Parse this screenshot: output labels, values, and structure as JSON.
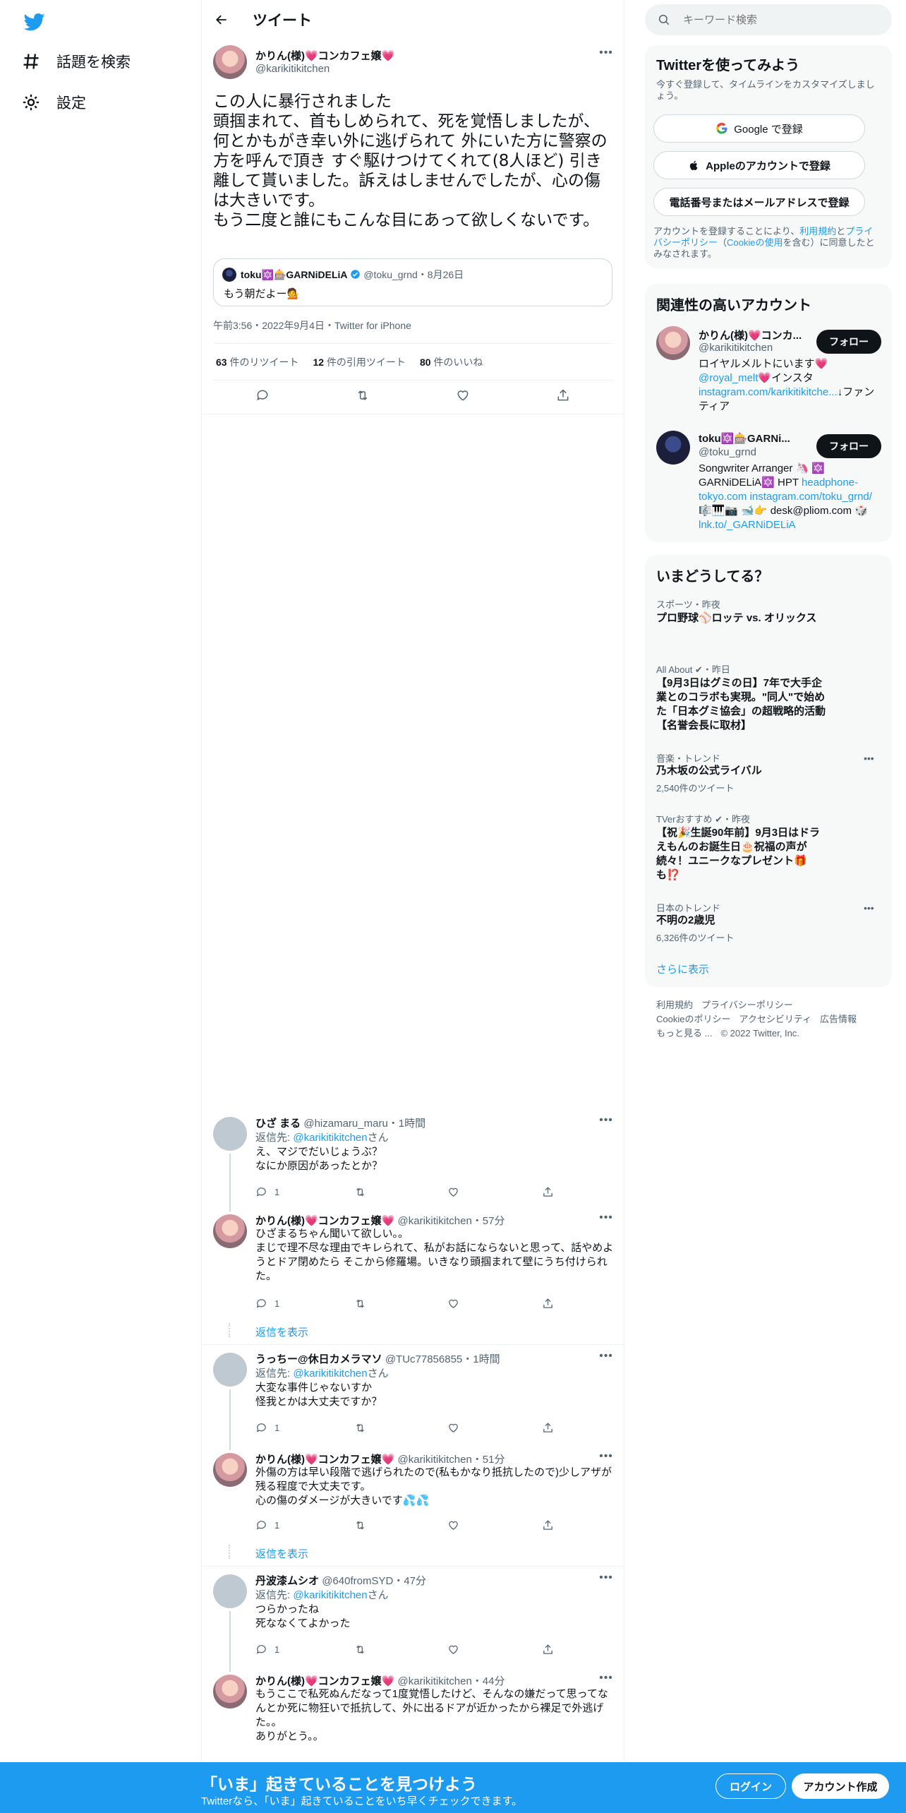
{
  "nav": {
    "explore": "話題を検索",
    "settings": "設定"
  },
  "header": {
    "title": "ツイート"
  },
  "main_tweet": {
    "name": "かりん(様)💗コンカフェ嬢💗",
    "handle": "@karikitikitchen",
    "text": "この人に暴行されました\n頭掴まれて、首もしめられて、死を覚悟しましたが、何とかもがき幸い外に逃げられて 外にいた方に警察の方を呼んで頂き すぐ駆けつけてくれて(8人ほど) 引き離して貰いました。訴えはしませんでしたが、心の傷は大きいです。\nもう二度と誰にもこんな目にあって欲しくないです。",
    "quote": {
      "name": "toku🔯🎰GARNiDELiA",
      "handle": "@toku_grnd",
      "date": "・8月26日",
      "text": "もう朝だよー💁"
    },
    "meta": "午前3:56・2022年9月4日・Twitter for iPhone",
    "retweets": "63",
    "retweets_label": "件のリツイート",
    "quotes": "12",
    "quotes_label": "件の引用ツイート",
    "likes": "80",
    "likes_label": "件のいいね"
  },
  "replies": [
    {
      "name": "ひざ まる",
      "handle": "@hizamaru_maru",
      "time": "・1時間",
      "reply_to_prefix": "返信先: ",
      "reply_to": "@karikitikitchen",
      "reply_to_suffix": "さん",
      "text": "え、マジでだいじょうぶ？\nなにか原因があったとか？",
      "replies_count": "1"
    },
    {
      "name": "かりん(様)💗コンカフェ嬢💗",
      "handle": "@karikitikitchen",
      "time": "・57分",
      "text": "ひざまるちゃん聞いて欲しい。。\nまじで理不尽な理由でキレられて、私がお話にならないと思って、話やめようとドア閉めたら そこから修羅場。いきなり頭掴まれて壁にうち付けられた。",
      "replies_count": "1"
    },
    {
      "name": "うっちー@休日カメラマソ",
      "handle": "@TUc77856855",
      "time": "・1時間",
      "reply_to_prefix": "返信先: ",
      "reply_to": "@karikitikitchen",
      "reply_to_suffix": "さん",
      "text": "大変な事件じゃないすか\n怪我とかは大丈夫ですか？",
      "replies_count": "1"
    },
    {
      "name": "かりん(様)💗コンカフェ嬢💗",
      "handle": "@karikitikitchen",
      "time": "・51分",
      "text": "外傷の方は早い段階で逃げられたので(私もかなり抵抗したので)少しアザが残る程度で大丈夫です。\n心の傷のダメージが大きいです💦💦",
      "replies_count": "1"
    },
    {
      "name": "丹波漆ムシオ",
      "handle": "@640fromSYD",
      "time": "・47分",
      "reply_to_prefix": "返信先: ",
      "reply_to": "@karikitikitchen",
      "reply_to_suffix": "さん",
      "text": "つらかったね\n死ななくてよかった",
      "replies_count": "1"
    },
    {
      "name": "かりん(様)💗コンカフェ嬢💗",
      "handle": "@karikitikitchen",
      "time": "・44分",
      "text": "もうここで私死ぬんだなって1度覚悟したけど、そんなの嫌だって思ってなんとか死に物狂いで抵抗して、外に出るドアが近かったから裸足で外逃げた。。\nありがとう。。",
      "replies_count": ""
    }
  ],
  "show_replies": "返信を表示",
  "search": {
    "placeholder": "キーワード検索"
  },
  "signup_card": {
    "title": "Twitterを使ってみよう",
    "subtitle": "今すぐ登録して、タイムラインをカスタマイズしましょう。",
    "google": "Google で登録",
    "apple": "Appleのアカウントで登録",
    "phone": "電話番号またはメールアドレスで登録",
    "legal_1": "アカウントを登録することにより、",
    "legal_terms": "利用規約",
    "legal_2": "と",
    "legal_privacy": "プライバシーポリシー",
    "legal_3": "（",
    "legal_cookie": "Cookieの使用",
    "legal_4": "を含む）に同意したとみなされます。"
  },
  "related": {
    "title": "関連性の高いアカウント",
    "follow": "フォロー",
    "accounts": [
      {
        "name": "かりん(様)💗コンカ...",
        "handle": "@karikitikitchen",
        "bio_1": "ロイヤルメルトにいます💗",
        "bio_link1": "@royal_melt",
        "bio_2": "💗インスタ",
        "bio_link2": "instagram.com/karikitikitche...",
        "bio_3": "↓ファンティア"
      },
      {
        "name": "toku🔯🎰GARNi...",
        "handle": "@toku_grnd",
        "bio_1": "Songwriter Arranger 🦄 🔯 GARNiDELiA🔯 HPT ",
        "bio_link1": "headphone-tokyo.com",
        "bio_2": " ",
        "bio_link2": "instagram.com/toku_grnd/",
        "bio_3": " 🎼🎹📷 🐋👉 desk@pliom.com 🎲 ",
        "bio_link3": "lnk.to/_GARNiDELiA"
      }
    ]
  },
  "trends": {
    "title": "いまどうしてる？",
    "items": [
      {
        "meta": "スポーツ・昨夜",
        "title": "プロ野球⚾ロッテ vs. オリックス",
        "count": ""
      },
      {
        "meta": "All About ✔・昨日",
        "title": "【9月3日はグミの日】7年で大手企業とのコラボも実現。\"同人\"で始めた「日本グミ協会」の超戦略的活動【名誉会長に取材】",
        "count": ""
      },
      {
        "meta": "音楽・トレンド",
        "title": "乃木坂の公式ライバル",
        "count": "2,540件のツイート"
      },
      {
        "meta": "TVerおすすめ ✔・昨夜",
        "title": "【祝🎉生誕90年前】9月3日はドラえもんのお誕生日🎂祝福の声が続々！ユニークなプレゼント🎁も⁉️",
        "count": ""
      },
      {
        "meta": "日本のトレンド",
        "title": "不明の2歳児",
        "count": "6,326件のツイート"
      }
    ],
    "show_more": "さらに表示"
  },
  "footer": {
    "terms": "利用規約",
    "privacy": "プライバシーポリシー",
    "cookie": "Cookieのポリシー",
    "accessibility": "アクセシビリティ",
    "ads": "広告情報",
    "more": "もっと見る ...",
    "copyright": "© 2022 Twitter, Inc."
  },
  "bottombar": {
    "title": "「いま」起きていることを見つけよう",
    "subtitle": "Twitterなら、「いま」起きていることをいち早くチェックできます。",
    "login": "ログイン",
    "signup": "アカウント作成"
  },
  "colors": {
    "accent": "#1d9bf0",
    "text": "#0f1419",
    "muted": "#536471"
  }
}
